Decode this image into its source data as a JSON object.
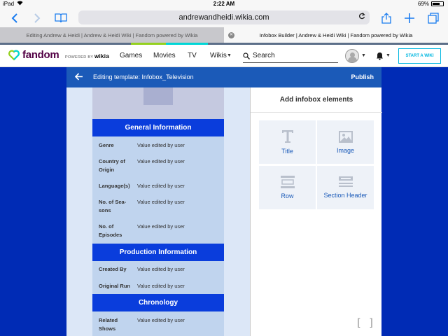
{
  "status_bar": {
    "device": "iPad",
    "time": "2:22 AM",
    "battery": "69%"
  },
  "browser": {
    "url": "andrewandheidi.wikia.com"
  },
  "tabs": [
    {
      "label": "Editing Andrew & Heidi | Andrew & Heidi Wiki | Fandom powered by Wikia",
      "active": false
    },
    {
      "label": "Infobox Builder | Andrew & Heidi Wiki | Fandom powered by Wikia",
      "active": true
    }
  ],
  "fandom_nav": {
    "logo_text": "fandom",
    "powered_by": "POWERED BY",
    "powered_brand": "wikia",
    "links": [
      "Games",
      "Movies",
      "TV",
      "Wikis"
    ],
    "search_placeholder": "Search",
    "start_wiki": "START A WIKI"
  },
  "colors": {
    "accent": "#1b5ab8",
    "page_bg": "#002bb5",
    "group_header": "#0a3ddc",
    "fandom_start": "#00b7e0"
  },
  "editor": {
    "title": "Editing template: Infobox_Television",
    "publish": "Publish"
  },
  "infobox": {
    "groups": [
      {
        "header": "General Information",
        "rows": [
          {
            "label": "Genre",
            "value": "Value edited by user"
          },
          {
            "label": "Country of Origin",
            "value": "Value edited by user"
          },
          {
            "label": "Language(s)",
            "value": "Value edited by user"
          },
          {
            "label": "No. of Sea-sons",
            "value": "Value edited by user"
          },
          {
            "label": "No. of Episodes",
            "value": "Value edited by user"
          }
        ]
      },
      {
        "header": "Production Information",
        "rows": [
          {
            "label": "Created By",
            "value": "Value edited by user"
          },
          {
            "label": "Original Run",
            "value": "Value edited by user"
          }
        ]
      },
      {
        "header": "Chronology",
        "rows": [
          {
            "label": "Related Shows",
            "value": "Value edited by user"
          }
        ]
      }
    ]
  },
  "elements_panel": {
    "title": "Add infobox elements",
    "items": [
      {
        "label": "Title",
        "icon": "title-icon"
      },
      {
        "label": "Image",
        "icon": "image-icon"
      },
      {
        "label": "Row",
        "icon": "row-icon"
      },
      {
        "label": "Section Header",
        "icon": "section-header-icon"
      }
    ]
  }
}
